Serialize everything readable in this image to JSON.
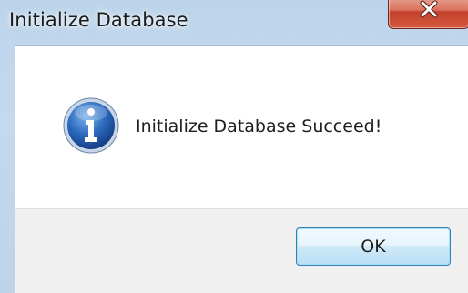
{
  "window": {
    "title": "Initialize Database",
    "close_icon": "close-x-icon"
  },
  "dialog": {
    "icon": "info-icon",
    "message": "Initialize Database Succeed!"
  },
  "buttons": {
    "ok_label": "OK"
  },
  "colors": {
    "accent": "#3c7fb1",
    "close_button": "#c2412b",
    "info_icon": "#1f5fb0"
  }
}
